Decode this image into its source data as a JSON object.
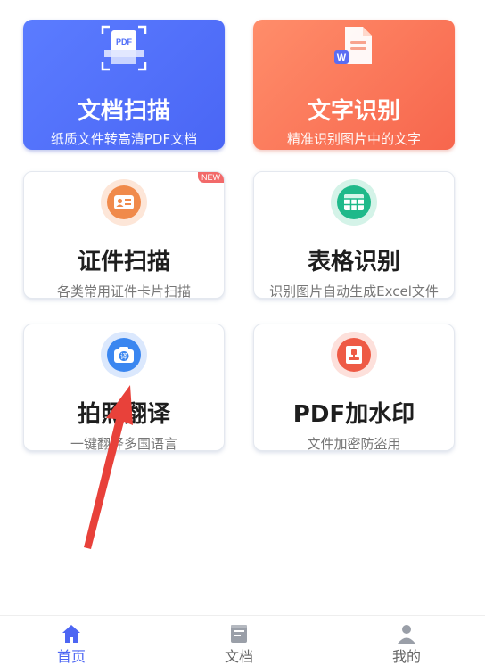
{
  "cards": [
    {
      "title": "文档扫描",
      "subtitle": "纸质文件转高清PDF文档",
      "icon": "scan-document-icon",
      "icon_text": "PDF",
      "color": "#4f6ef8"
    },
    {
      "title": "文字识别",
      "subtitle": "精准识别图片中的文字",
      "icon": "word-document-icon",
      "icon_text": "W",
      "color": "#f8725a"
    },
    {
      "title": "证件扫描",
      "subtitle": "各类常用证件卡片扫描",
      "icon": "id-card-icon",
      "badge": "NEW",
      "color": "#f08a4b"
    },
    {
      "title": "表格识别",
      "subtitle": "识别图片自动生成Excel文件",
      "icon": "table-icon",
      "color": "#1fb98a"
    },
    {
      "title": "拍照翻译",
      "subtitle": "一键翻译多国语言",
      "icon": "camera-translate-icon",
      "icon_text": "译",
      "color": "#3a86f0"
    },
    {
      "title": "PDF加水印",
      "subtitle": "文件加密防盗用",
      "icon": "stamp-icon",
      "color": "#ee5a45"
    }
  ],
  "tabs": [
    {
      "label": "首页",
      "icon": "home-icon",
      "active": true
    },
    {
      "label": "文档",
      "icon": "document-icon",
      "active": false
    },
    {
      "label": "我的",
      "icon": "user-icon",
      "active": false
    }
  ],
  "accent_color": "#4d66f3",
  "annotation": {
    "type": "arrow",
    "color": "#e8413a"
  }
}
